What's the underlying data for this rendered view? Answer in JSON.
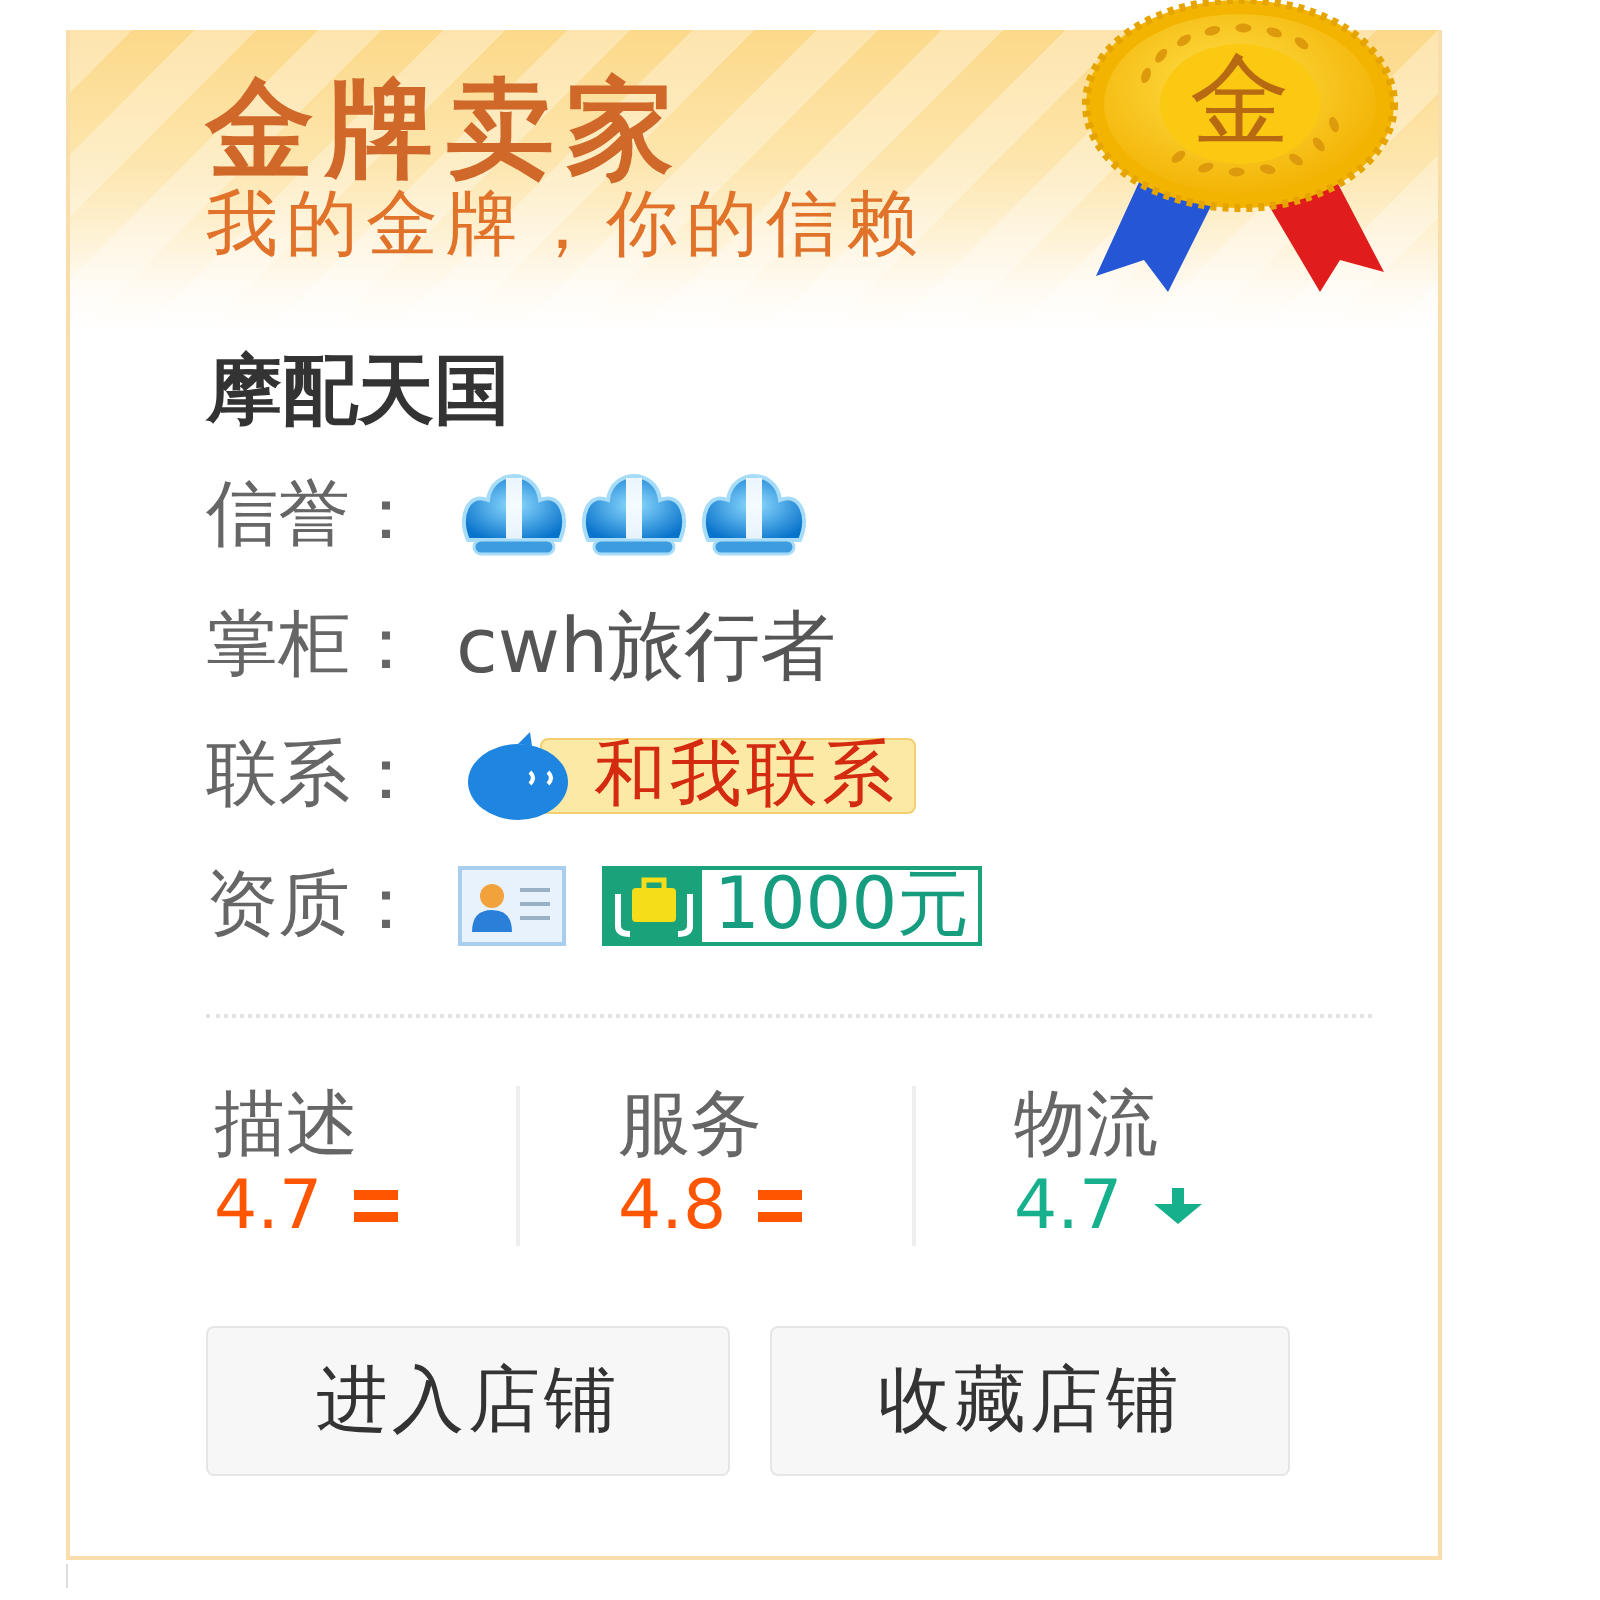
{
  "banner": {
    "title": "金牌卖家",
    "subtitle": "我的金牌，你的信赖",
    "medal_label": "金"
  },
  "shop": {
    "name": "摩配天国"
  },
  "fields": [
    {
      "kind": "rating",
      "label": "信誉：",
      "stars": 3
    },
    {
      "kind": "text",
      "label": "掌柜：",
      "value": "cwh旅行者"
    },
    {
      "kind": "contact",
      "label": "联系：",
      "button": "和我联系"
    },
    {
      "kind": "badges",
      "label": "资质：",
      "deposit": "1000元"
    }
  ],
  "scores": [
    {
      "kind": "equal",
      "label": "描述",
      "value": "4.7"
    },
    {
      "kind": "equal",
      "label": "服务",
      "value": "4.8"
    },
    {
      "kind": "down",
      "label": "物流",
      "value": "4.7"
    }
  ],
  "buttons": [
    {
      "label": "进入店铺"
    },
    {
      "label": "收藏店铺"
    }
  ]
}
